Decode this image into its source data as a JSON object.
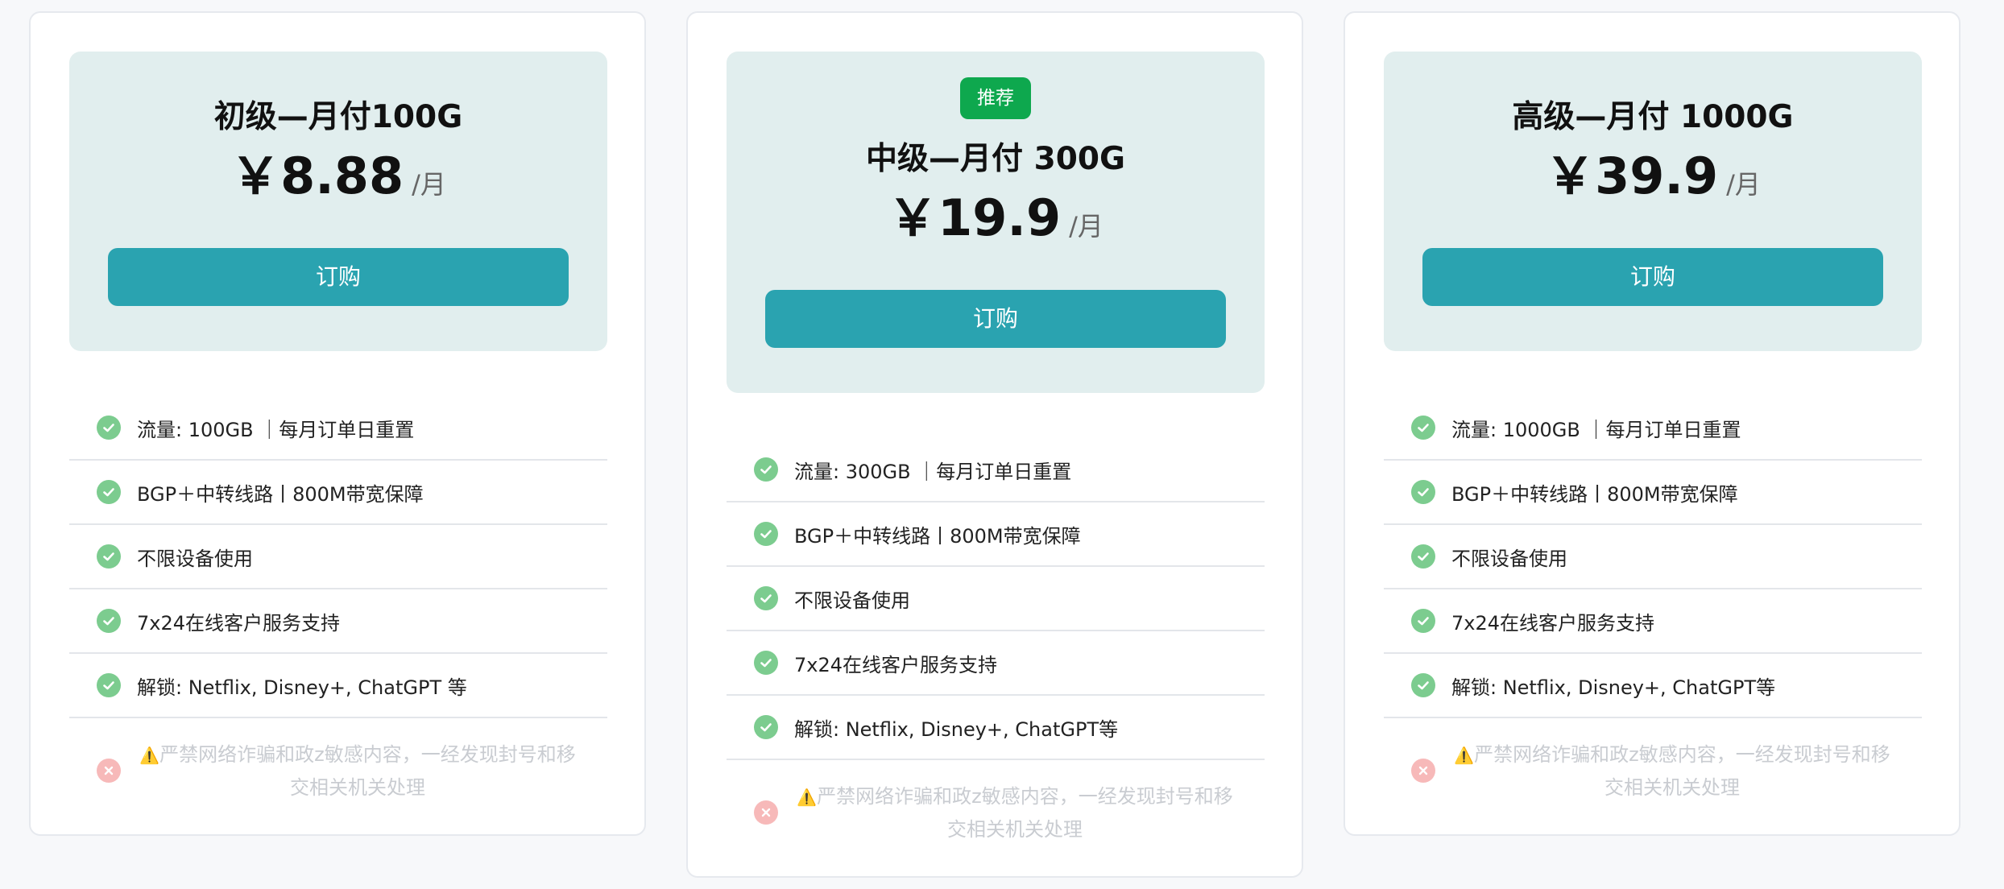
{
  "plans": [
    {
      "title": "初级—月付100G",
      "price": "￥8.88",
      "unit": "/月",
      "button": "订购",
      "features": [
        "流量: 100GB ｜每月订单日重置",
        "BGP＋中转线路丨800M带宽保障",
        "不限设备使用",
        "7x24在线客户服务支持",
        "解锁: Netflix, Disney+, ChatGPT 等"
      ],
      "warning_icon": "⚠️",
      "warning": "严禁网络诈骗和政z敏感内容，一经发现封号和移交相关机关处理"
    },
    {
      "badge": "推荐",
      "title": "中级—月付 300G",
      "price": "￥19.9",
      "unit": "/月",
      "button": "订购",
      "features": [
        "流量: 300GB ｜每月订单日重置",
        "BGP＋中转线路丨800M带宽保障",
        "不限设备使用",
        "7x24在线客户服务支持",
        "解锁: Netflix, Disney+, ChatGPT等"
      ],
      "warning_icon": "⚠️",
      "warning": "严禁网络诈骗和政z敏感内容，一经发现封号和移交相关机关处理"
    },
    {
      "title": "高级—月付 1000G",
      "price": "￥39.9",
      "unit": "/月",
      "button": "订购",
      "features": [
        "流量: 1000GB ｜每月订单日重置",
        "BGP＋中转线路丨800M带宽保障",
        "不限设备使用",
        "7x24在线客户服务支持",
        "解锁: Netflix, Disney+, ChatGPT等"
      ],
      "warning_icon": "⚠️",
      "warning": "严禁网络诈骗和政z敏感内容，一经发现封号和移交相关机关处理"
    }
  ],
  "colors": {
    "button": "#2aa3b0",
    "header_bg": "#e1eeee",
    "badge": "#0ea84e",
    "check": "#7ccc8f",
    "cross": "#f7b9b9"
  },
  "icons": {
    "feature": "check-circle-icon",
    "restriction": "x-circle-icon"
  }
}
